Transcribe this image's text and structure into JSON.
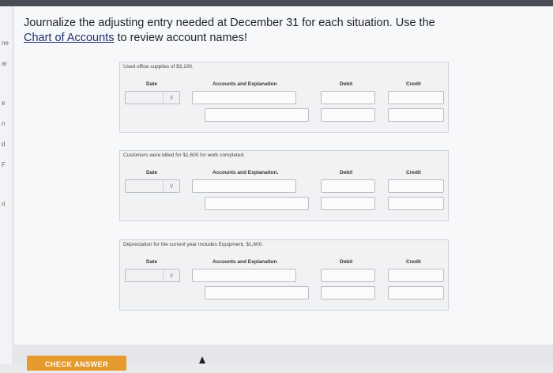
{
  "instruction": {
    "line1": "Journalize the adjusting entry needed at December 31 for each situation. Use the",
    "link": "Chart of Accounts",
    "line2_rest": " to review account names!"
  },
  "columns": {
    "date": "Date",
    "accounts": "Accounts and Explanation",
    "debit": "Debit",
    "credit": "Credit"
  },
  "scenarios": [
    {
      "text": "Used office supplies of $3,100.",
      "accounts_header": "Accounts and Explanation"
    },
    {
      "text": "Customers were billed for $1,600 for work completed.",
      "accounts_header": "Accounts and Explanation."
    },
    {
      "text": "Depreciation for the current year includes Equipment, $1,600.",
      "accounts_header": "Accounts and Explanation"
    }
  ],
  "buttons": {
    "check_answer": "CHECK ANSWER"
  },
  "icons": {
    "dropdown": "chevron-down-icon",
    "cursor": "mouse-pointer-icon"
  }
}
